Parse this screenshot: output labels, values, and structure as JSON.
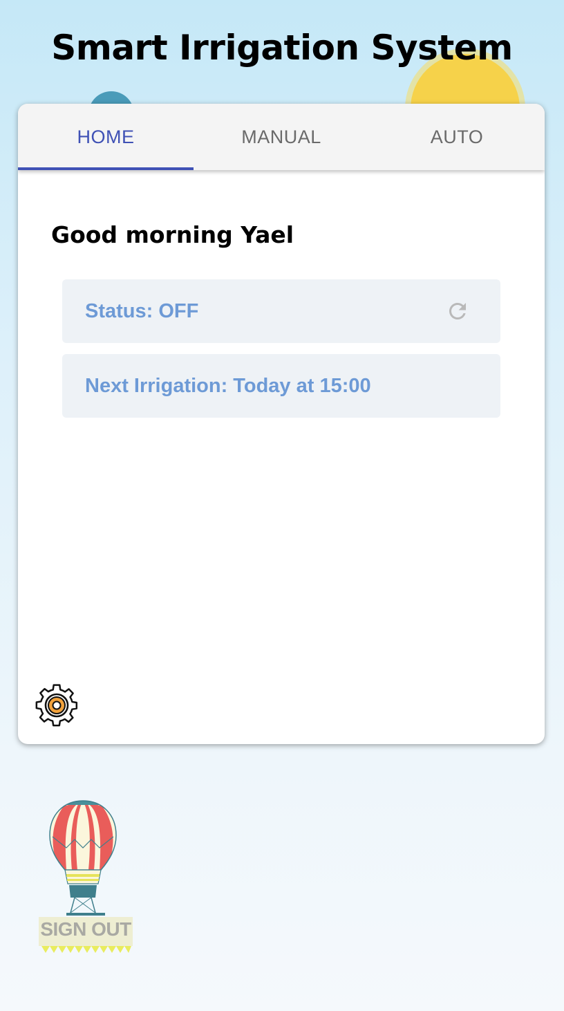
{
  "app": {
    "title": "Smart Irrigation System"
  },
  "tabs": [
    {
      "label": "HOME",
      "active": true
    },
    {
      "label": "MANUAL",
      "active": false
    },
    {
      "label": "AUTO",
      "active": false
    }
  ],
  "home": {
    "greeting": "Good morning Yael",
    "status_text": "Status: OFF",
    "next_irrigation_text": "Next Irrigation: Today at 15:00"
  },
  "signout": {
    "label": "SIGN OUT"
  },
  "icons": {
    "refresh": "refresh-icon",
    "settings": "gear-icon",
    "balloon": "hot-air-balloon-icon"
  },
  "colors": {
    "accent": "#3f51b5",
    "info_text": "#6d9ad6",
    "info_bg": "#eef2f6",
    "sun": "#f6d24a",
    "bubble": "#4a9bb9"
  }
}
